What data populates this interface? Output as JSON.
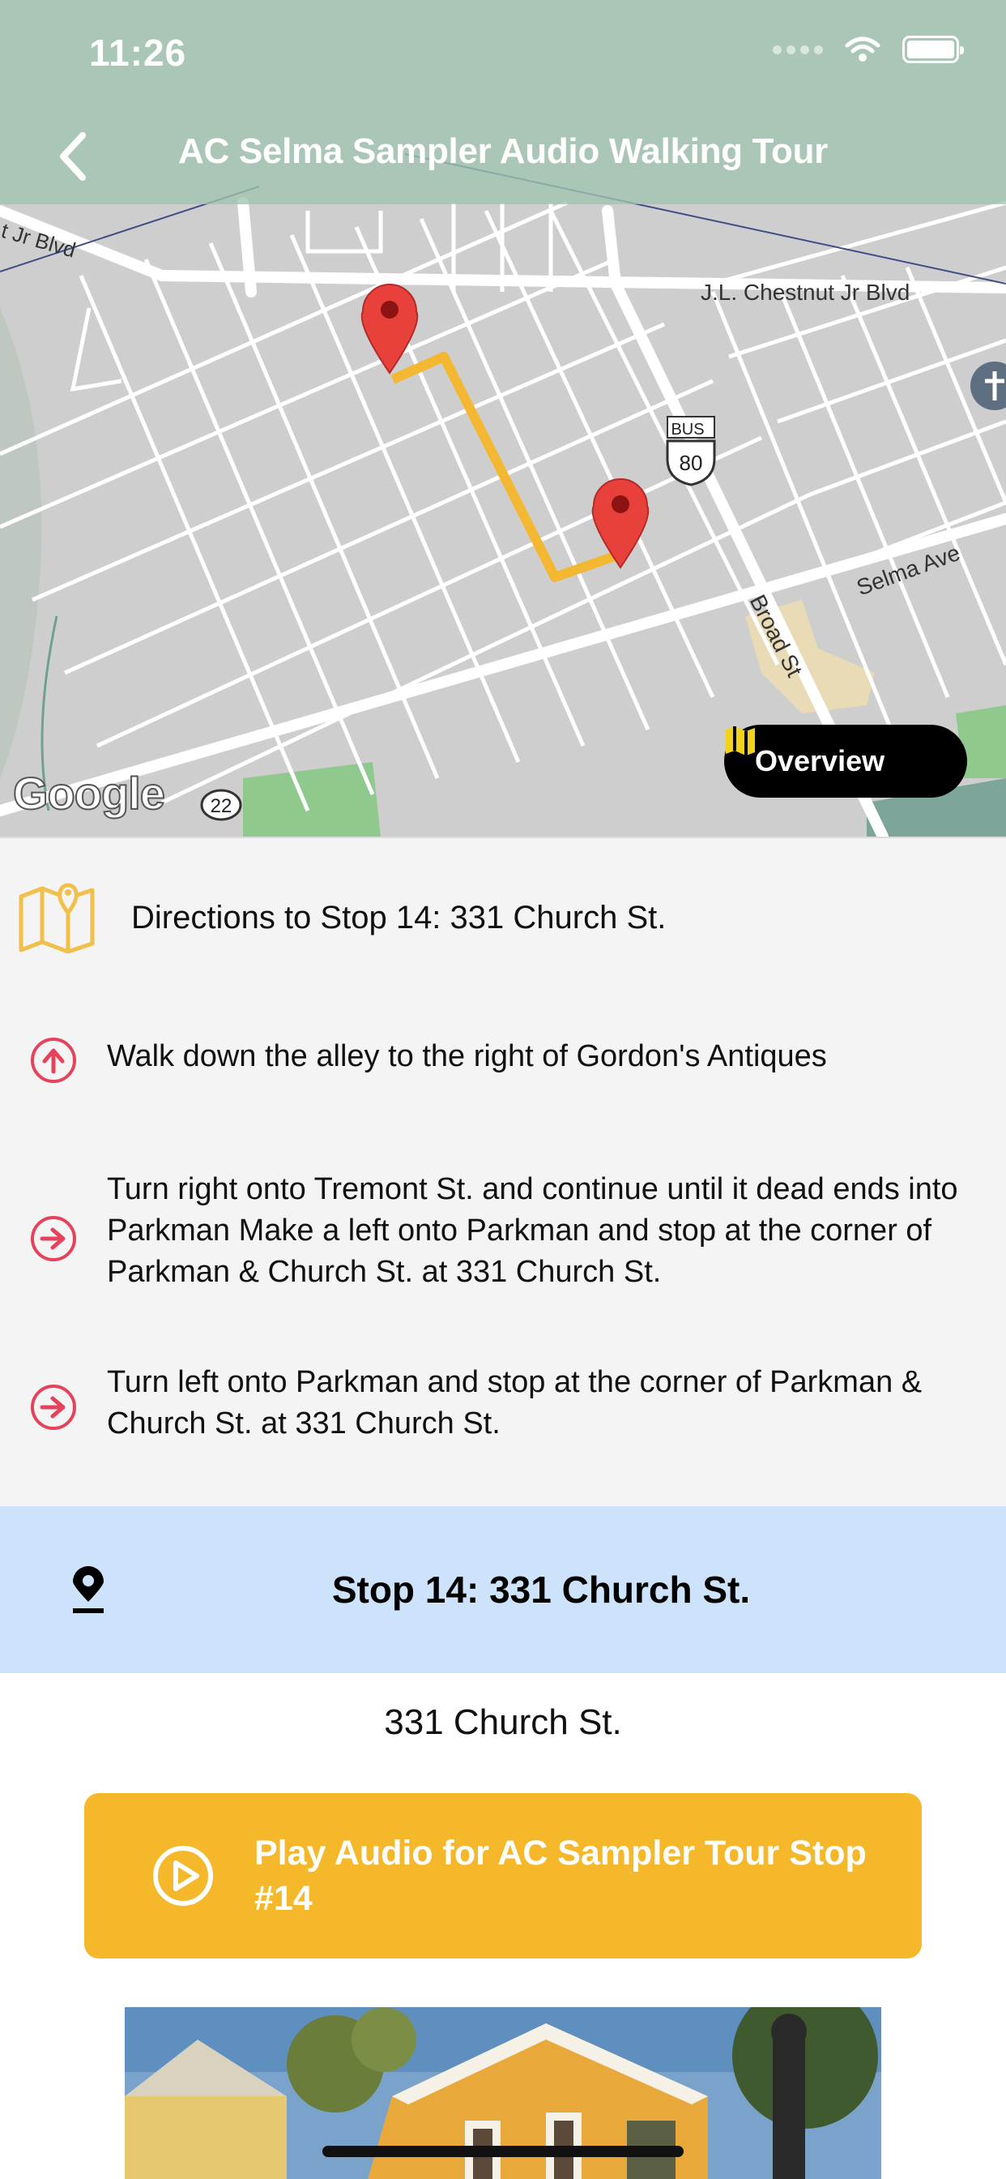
{
  "status_bar": {
    "time": "11:26"
  },
  "header": {
    "title": "AC Selma Sampler Audio Walking Tour"
  },
  "map": {
    "street_labels": {
      "mlk": "t Jr Blvd",
      "chestnut": "J.L. Chestnut Jr Blvd",
      "selma_ave": "Selma Ave",
      "broad": "Broad St"
    },
    "route_shield_bus": "BUS",
    "route_shield_number": "80",
    "route_22": "22",
    "provider_logo": "Google",
    "overview_label": "Overview",
    "colors": {
      "route": "#f3b731",
      "pin": "#e8403b"
    }
  },
  "directions": {
    "heading": "Directions to Stop 14: 331 Church St.",
    "steps": [
      {
        "icon": "arrow-up-circle-icon",
        "text": "Walk down the alley to the right of Gordon's Antiques"
      },
      {
        "icon": "arrow-right-circle-icon",
        "text": "Turn right onto Tremont St. and continue until it dead ends into Parkman Make a left onto Parkman and stop at the corner of Parkman & Church St. at 331 Church St."
      },
      {
        "icon": "arrow-right-circle-icon",
        "text": "Turn left onto Parkman and stop at the corner of Parkman & Church St. at 331 Church St."
      }
    ]
  },
  "stop": {
    "title": "Stop 14: 331 Church St.",
    "address": "331 Church St.",
    "play_label": "Play Audio for AC Sampler Tour Stop #14"
  },
  "colors": {
    "accent": "#f4b82a",
    "banner": "#cce3fb",
    "step_icon": "#e4435b"
  }
}
